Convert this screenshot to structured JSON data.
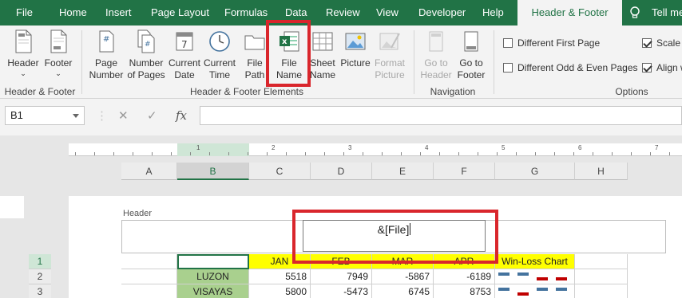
{
  "tabs": [
    "File",
    "Home",
    "Insert",
    "Page Layout",
    "Formulas",
    "Data",
    "Review",
    "View",
    "Developer",
    "Help",
    "Header & Footer",
    "Tell me"
  ],
  "ribbon": {
    "header_label": "Header",
    "footer_label": "Footer",
    "group_hf": "Header & Footer",
    "page_number": "Page Number",
    "number_of_pages": "Number of Pages",
    "current_date": "Current Date",
    "current_time": "Current Time",
    "file_path": "File Path",
    "file_name": "File Name",
    "sheet_name": "Sheet Name",
    "picture": "Picture",
    "format_picture": "Format Picture",
    "group_elements": "Header & Footer Elements",
    "go_to_header": "Go to Header",
    "go_to_footer": "Go to Footer",
    "group_navigation": "Navigation",
    "different_first_page": "Different First Page",
    "different_odd_even": "Different Odd & Even Pages",
    "scale_with": "Scale w",
    "align_with": "Align w",
    "group_options": "Options"
  },
  "formula_bar": {
    "name_box": "B1",
    "fx": "fx",
    "value": ""
  },
  "ruler_numbers": [
    "1",
    "2",
    "3",
    "4",
    "5",
    "6",
    "7"
  ],
  "columns": [
    "A",
    "B",
    "C",
    "D",
    "E",
    "F",
    "G",
    "H"
  ],
  "header": {
    "label": "Header",
    "center_text": "&[File]"
  },
  "rows": [
    {
      "num": "1",
      "b": "",
      "c": "JAN",
      "d": "FEB",
      "e": "MAR",
      "f": "APR",
      "g": "Win-Loss Chart"
    },
    {
      "num": "2",
      "b": "LUZON",
      "c": "5518",
      "d": "7949",
      "e": "-5867",
      "f": "-6189"
    },
    {
      "num": "3",
      "b": "VISAYAS",
      "c": "5800",
      "d": "-5473",
      "e": "6745",
      "f": "8753"
    }
  ],
  "colors": {
    "brand": "#217346",
    "highlight": "#d9262c",
    "win": "#44739e",
    "loss": "#c00000",
    "month_header_fill": "#ffff00",
    "region_fill": "#a9d08e"
  }
}
